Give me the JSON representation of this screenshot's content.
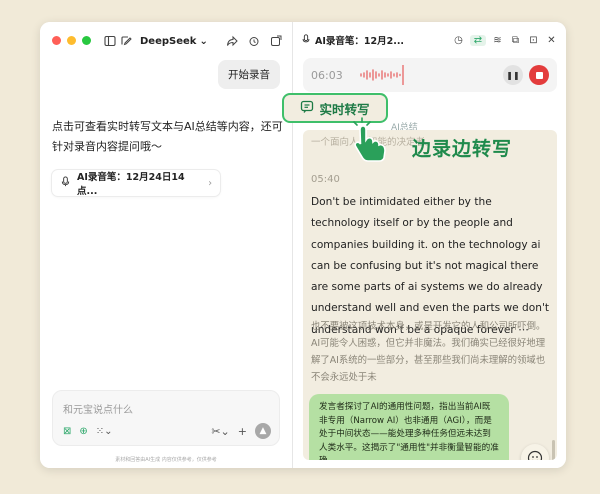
{
  "left": {
    "model": "DeepSeek",
    "user_bubble": "开始录音",
    "assistant_text": "点击可查看实时转写文本与AI总结等内容，还可针对录音内容提问哦～",
    "link_chip": "AI录音笔：12月24日14点...",
    "composer_placeholder": "和元宝说点什么",
    "footer_note": "素材和回答由AI生成 内容仅供参考，仅供参考"
  },
  "right": {
    "title": "AI录音笔：12月2...",
    "player_time": "06:03",
    "tab_ai": "AI总结",
    "faded_line": "一个面向人工智能的决定者。",
    "timestamp": "05:40",
    "english_text": "Don't be intimidated either by the technology itself or by the people and companies building it. on the technology ai can be confusing but it's not magical there are some parts of ai systems we do already understand well and even the parts we don't understand won't be a opaque forever ⋯",
    "chinese_text": "也不要被这项技术本身，或是开发它的人和公司所吓倒。AI可能令人困惑，但它并非魔法。我们确实已经很好地理解了AI系统的一些部分，甚至那些我们尚未理解的领域也不会永远处于未",
    "summary": "发言者探讨了AI的通用性问题，指出当前AI既非专用（Narrow AI）也非通用（AGI），而是处于中间状态——能处理多种任务但远未达到人类水平。这揭示了\"通用性\"并非衡量智能的准确..."
  },
  "overlay": {
    "tab_label": "实时转写",
    "caption": "边录边转写"
  },
  "colors": {
    "accent_green": "#3fbf6a",
    "stop_red": "#e33c3c",
    "summary_bg": "#b5e0a3",
    "page_bg": "#f1ead8"
  }
}
